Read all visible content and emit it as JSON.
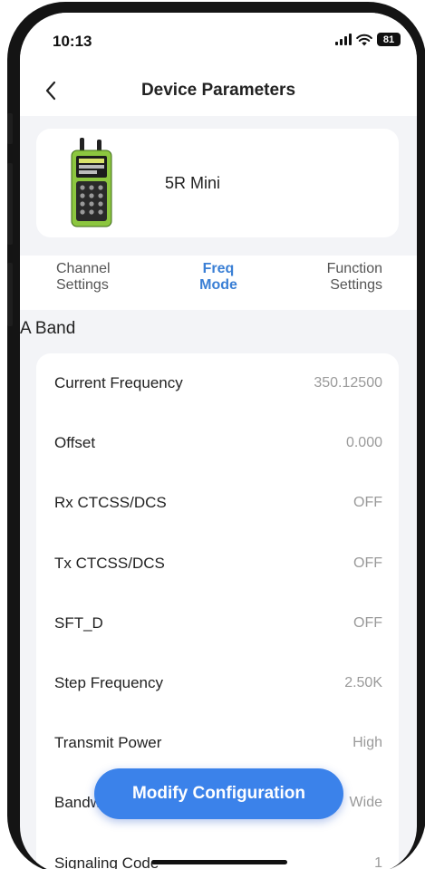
{
  "status_bar": {
    "time": "10:13",
    "battery": "81",
    "icons": [
      "signal-icon",
      "wifi-icon",
      "battery-icon"
    ]
  },
  "nav": {
    "title": "Device Parameters",
    "back_icon": "chevron-left-icon"
  },
  "device": {
    "name": "5R Mini",
    "image": "walkie-talkie-device-image"
  },
  "tabs": [
    {
      "label": "Channel Settings",
      "line1": "Channel",
      "line2": "Settings",
      "active": false
    },
    {
      "label": "Freq Mode",
      "line1": "Freq",
      "line2": "Mode",
      "active": true
    },
    {
      "label": "Function Settings",
      "line1": "Function",
      "line2": "Settings",
      "active": false
    }
  ],
  "section": {
    "title": "A Band"
  },
  "params": [
    {
      "label": "Current Frequency",
      "value": "350.12500"
    },
    {
      "label": "Offset",
      "value": "0.000"
    },
    {
      "label": "Rx CTCSS/DCS",
      "value": "OFF"
    },
    {
      "label": "Tx CTCSS/DCS",
      "value": "OFF"
    },
    {
      "label": "SFT_D",
      "value": "OFF"
    },
    {
      "label": "Step Frequency",
      "value": "2.50K"
    },
    {
      "label": "Transmit Power",
      "value": "High"
    },
    {
      "label": "Bandwidth",
      "value": "Wide"
    },
    {
      "label": "Signaling Code",
      "value": "1"
    }
  ],
  "actions": {
    "modify_label": "Modify Configuration"
  },
  "colors": {
    "accent": "#3b82ea",
    "active_tab": "#3a7fd5",
    "device_body": "#8cc63f",
    "background": "#f3f4f7"
  }
}
